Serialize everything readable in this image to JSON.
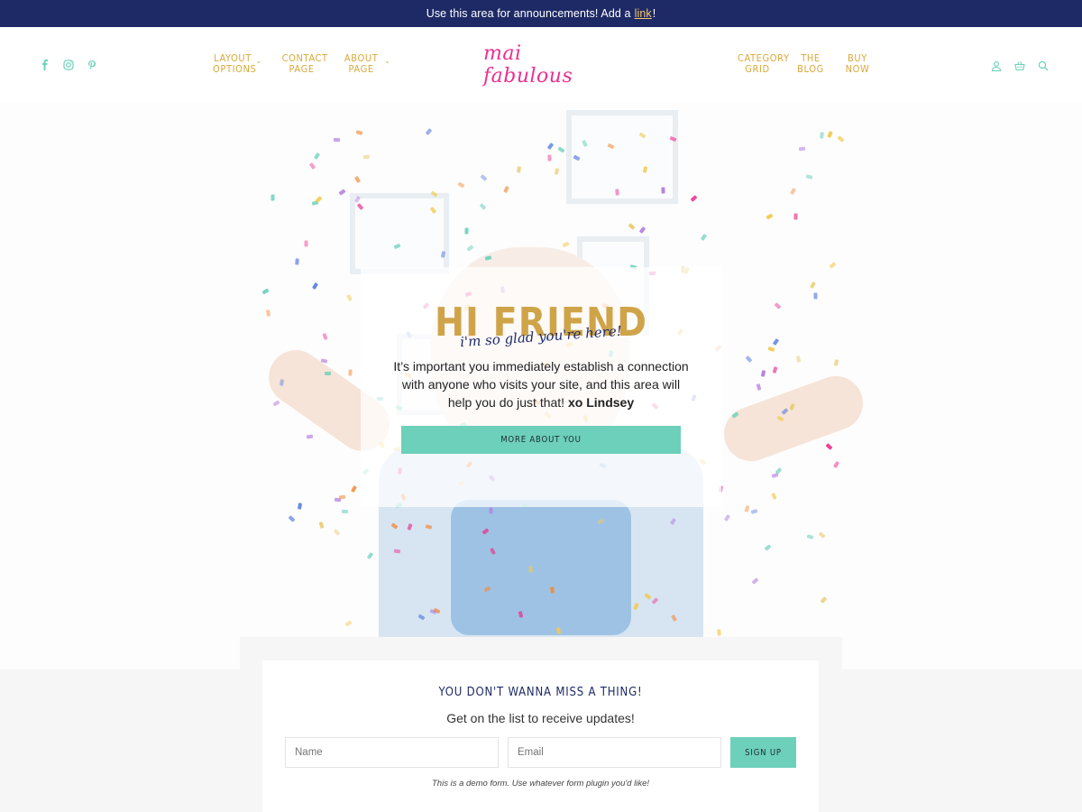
{
  "announcement": {
    "text": "Use this area for announcements! Add a",
    "link_label": "link",
    "suffix": "!"
  },
  "header": {
    "social": [
      {
        "icon": "facebook-icon",
        "glyph": "f"
      },
      {
        "icon": "instagram-icon",
        "glyph": "◎"
      },
      {
        "icon": "pinterest-icon",
        "glyph": "p"
      }
    ],
    "nav_left": [
      {
        "label": "LAYOUT OPTIONS",
        "has_dropdown": true
      },
      {
        "label": "CONTACT PAGE",
        "has_dropdown": false
      },
      {
        "label": "ABOUT PAGE",
        "has_dropdown": true
      }
    ],
    "logo": "mai fabulous",
    "nav_right": [
      {
        "label": "CATEGORY GRID"
      },
      {
        "label": "THE BLOG"
      },
      {
        "label": "BUY NOW"
      }
    ],
    "utility_icons": [
      "user-icon",
      "cart-icon",
      "search-icon"
    ]
  },
  "hero": {
    "title": "HI FRIEND",
    "script": "i'm so glad you're here!",
    "text_main": "It’s important you immediately establish a connection with anyone who visits your site, and this area will help you do just that!",
    "text_sign": "xo Lindsey",
    "button_label": "MORE ABOUT YOU"
  },
  "signup": {
    "title": "YOU DON'T WANNA MISS A THING!",
    "subtitle": "Get on the list to receive updates!",
    "name_placeholder": "Name",
    "email_placeholder": "Email",
    "button_label": "SIGN UP",
    "note": "This is a demo form. Use whatever form plugin you'd like!"
  },
  "colors": {
    "navy": "#1e2a66",
    "gold": "#d9a93c",
    "pink": "#ec2f8f",
    "teal": "#6dd0bb"
  }
}
